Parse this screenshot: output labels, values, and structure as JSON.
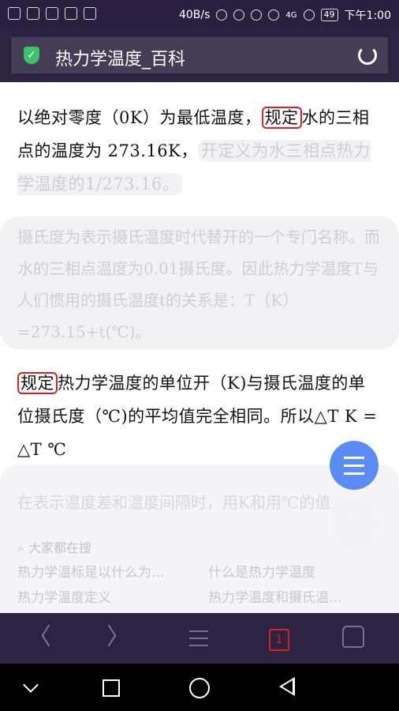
{
  "status_bar": {
    "speed": "40B/s",
    "network": "4G",
    "battery": "49",
    "time": "下午1:00"
  },
  "url_bar": {
    "page_title": "热力学温度_百科",
    "icons": [
      "shield-check-icon",
      "reload-icon"
    ]
  },
  "content": {
    "p1_a": "以绝对零度（0K）为最低温度，",
    "p1_hl": "规定",
    "p1_b": "水的三相点的温度为 273.16K，",
    "p1_faded": "开定义为水三相点热力学温度的1/273.16。",
    "p2_faded": "摄氏度为表示摄氏温度时代替开的一个专门名称。而水的三相点温度为0.01摄氏度。因此热力学温度T与人们惯用的摄氏温度t的关系是：T（K）=273.15+t(℃)。",
    "p3_hl": "规定",
    "p3_b": "热力学温度的单位开（K)与摄氏温度的单位摄氏度（℃)的平均值完全相同。所以△T K = △T ℃",
    "p4_faded": "在表示温度差和温度间隔时，用K和用℃的值"
  },
  "suggestions": {
    "title": "大家都在搜",
    "items": [
      "热力学温标是以什么为…",
      "什么是热力学温度",
      "热力学温度定义",
      "热力学温度和摄氏温…"
    ]
  },
  "toolbar": {
    "back": "〈",
    "forward": "〉",
    "tab_count": "1"
  },
  "colors": {
    "status_bg": "#2a1f3f",
    "highlight_border": "#d6202a",
    "fab_blue": "#5b8cf5",
    "shield_green": "#3cc26a"
  }
}
